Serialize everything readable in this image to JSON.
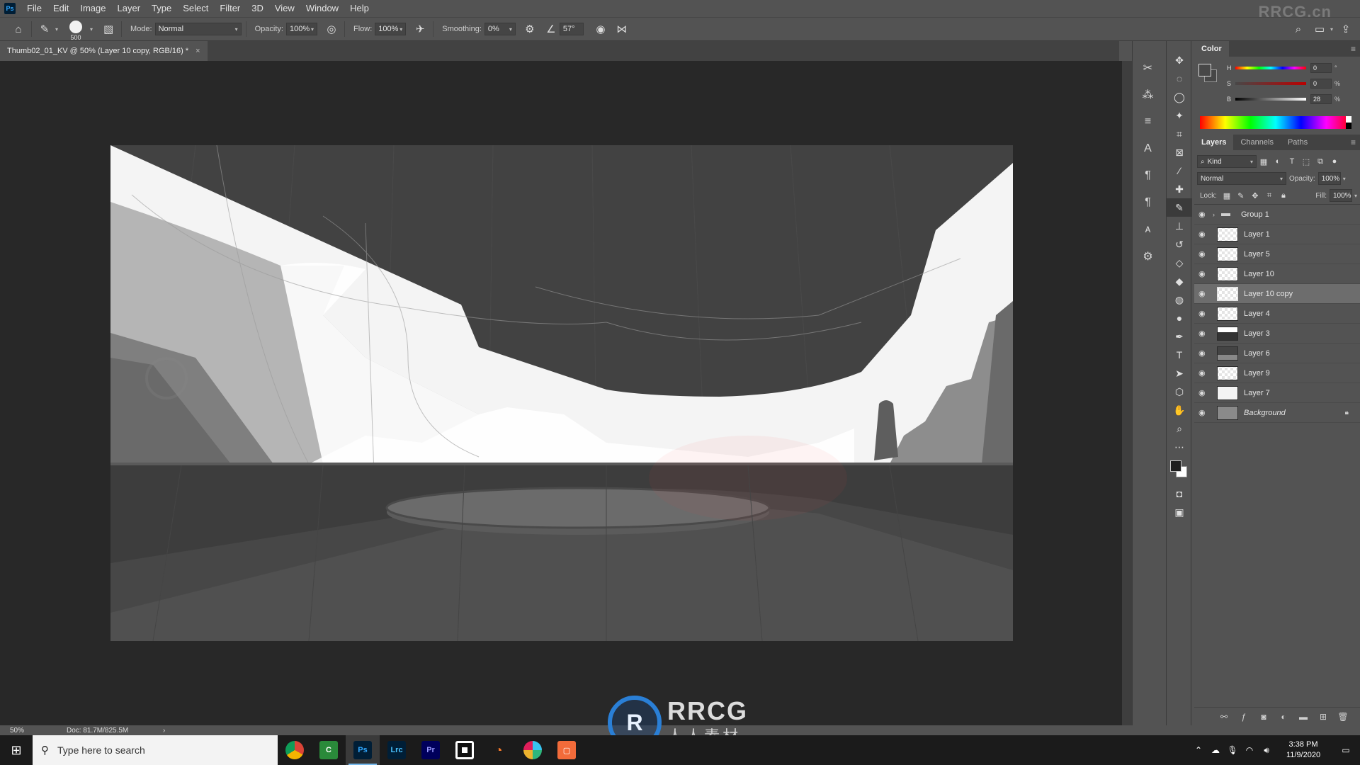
{
  "menubar": {
    "logo": "Ps",
    "items": [
      "File",
      "Edit",
      "Image",
      "Layer",
      "Type",
      "Select",
      "Filter",
      "3D",
      "View",
      "Window",
      "Help"
    ],
    "watermark": "RRCG.cn"
  },
  "options": {
    "brush_size": "500",
    "mode_label": "Mode:",
    "mode_value": "Normal",
    "opacity_label": "Opacity:",
    "opacity_value": "100%",
    "flow_label": "Flow:",
    "flow_value": "100%",
    "smoothing_label": "Smoothing:",
    "smoothing_value": "0%",
    "angle_value": "57°"
  },
  "document": {
    "tab_title": "Thumb02_01_KV @ 50% (Layer 10 copy, RGB/16) *",
    "tab_close": "×"
  },
  "status": {
    "zoom": "50%",
    "doc": "Doc: 81.7M/825.5M",
    "arrow": "›"
  },
  "color_panel": {
    "tab": "Color",
    "h_label": "H",
    "h_value": "0",
    "h_unit": "°",
    "s_label": "S",
    "s_value": "0",
    "s_unit": "%",
    "b_label": "B",
    "b_value": "28",
    "b_unit": "%"
  },
  "layers_panel": {
    "tabs": [
      "Layers",
      "Channels",
      "Paths"
    ],
    "kind_label": "Kind",
    "blend_mode": "Normal",
    "opacity_label": "Opacity:",
    "opacity_value": "100%",
    "lock_label": "Lock:",
    "fill_label": "Fill:",
    "fill_value": "100%",
    "layers": [
      {
        "name": "Group 1"
      },
      {
        "name": "Layer 1"
      },
      {
        "name": "Layer 5"
      },
      {
        "name": "Layer 10"
      },
      {
        "name": "Layer 10 copy"
      },
      {
        "name": "Layer 4"
      },
      {
        "name": "Layer 3"
      },
      {
        "name": "Layer 6"
      },
      {
        "name": "Layer 9"
      },
      {
        "name": "Layer 7"
      },
      {
        "name": "Background"
      }
    ]
  },
  "watermark": {
    "logo_letters": "R",
    "brand": "RRCG",
    "subtitle": "人人素材"
  },
  "taskbar": {
    "search_placeholder": "Type here to search",
    "apps": [
      "Chrome",
      "C",
      "Ps",
      "Lrc",
      "Pr",
      "Player",
      "Blender",
      "Slack",
      "App"
    ],
    "time": "3:38 PM",
    "date": "11/9/2020"
  },
  "colors": {
    "accent": "#31a8ff",
    "selected_row": "#6d6d6d",
    "canvas_bg": "#282828"
  }
}
